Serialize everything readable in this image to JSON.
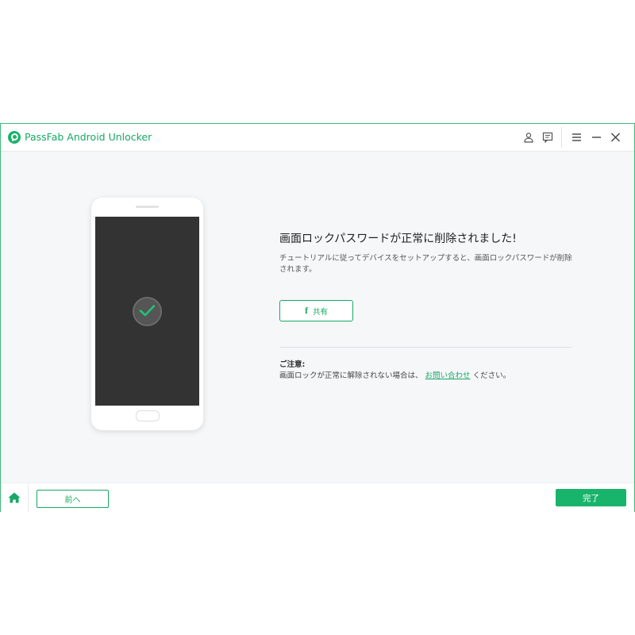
{
  "window": {
    "app_title": "PassFab Android Unlocker",
    "accent_color": "#18b46b",
    "titlebar_icons": [
      "user-icon",
      "feedback-icon",
      "menu-icon",
      "minimize-icon",
      "close-icon"
    ]
  },
  "content": {
    "headline": "画面ロックパスワードが正常に削除されました!",
    "description": "チュートリアルに従ってデバイスをセットアップすると、画面ロックパスワードが削除されます。",
    "share_button_label": "共有",
    "note_title": "ご注意:",
    "note_prefix": "画面ロックが正常に解除されない場合は、",
    "note_link": "お問い合わせ",
    "note_suffix": "ください。"
  },
  "footer": {
    "back_label": "前へ",
    "done_label": "完了"
  }
}
